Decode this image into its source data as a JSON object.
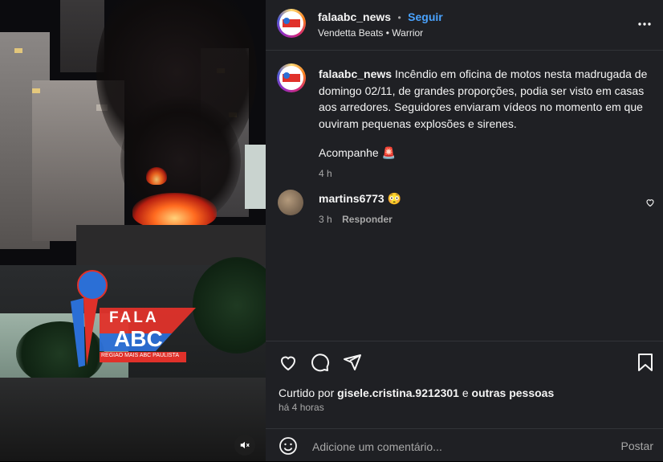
{
  "post": {
    "username": "falaabc_news",
    "separator": "•",
    "follow_label": "Seguir",
    "audio": "Vendetta Beats • Warrior",
    "more_icon": "more-options-icon"
  },
  "media": {
    "logo_line1": "FALA",
    "logo_line2": "ABC",
    "logo_tagline": "REGIÃO MAIS ABC PAULISTA",
    "mute_icon": "volume-muted-icon"
  },
  "caption": {
    "username": "falaabc_news",
    "text": "Incêndio em oficina de motos nesta madrugada de domingo 02/11, de grandes proporções, podia ser visto em casas aos arredores. Seguidores enviaram vídeos no momento em que ouviram pequenas explosões e sirenes.",
    "follow_up": "Acompanhe 🚨",
    "time": "4 h"
  },
  "comments": [
    {
      "username": "martins6773",
      "text": "😳",
      "time": "3 h",
      "reply_label": "Responder"
    }
  ],
  "likes": {
    "prefix": "Curtido por ",
    "user": "gisele.cristina.9212301",
    "joiner": " e ",
    "others": "outras pessoas"
  },
  "posted_ago": "há 4 horas",
  "comment_box": {
    "placeholder": "Adicione um comentário...",
    "post_label": "Postar"
  },
  "colors": {
    "accent": "#4aa3ff",
    "panel_bg": "#1f2024",
    "muted_text": "#a8a8a8",
    "logo_red": "#e0312a",
    "logo_blue": "#2b6fd6"
  }
}
